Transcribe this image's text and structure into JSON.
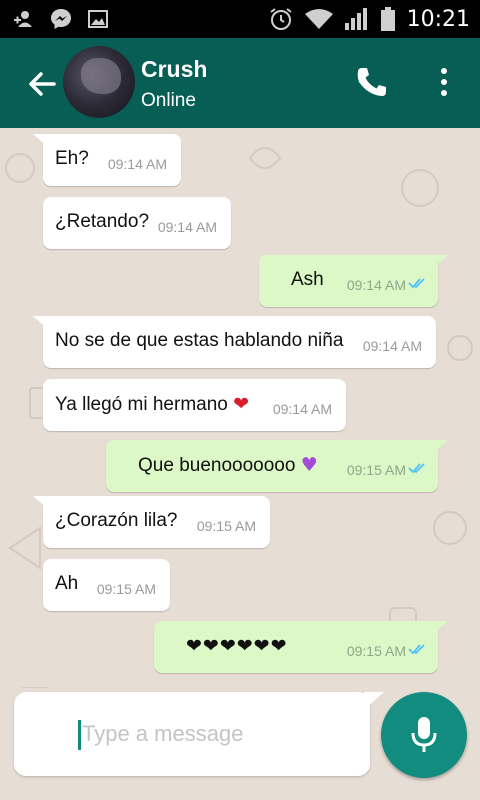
{
  "status_bar": {
    "time": "10:21"
  },
  "header": {
    "contact_name": "Crush",
    "contact_status": "Online"
  },
  "messages": [
    {
      "direction": "in",
      "text": "Eh?",
      "time": "09:14 AM"
    },
    {
      "direction": "in",
      "text": "¿Retando?",
      "time": "09:14 AM"
    },
    {
      "direction": "out",
      "text": "Ash",
      "time": "09:14 AM",
      "read": true
    },
    {
      "direction": "in",
      "text": "No se de que estas hablando niña",
      "time": "09:14 AM"
    },
    {
      "direction": "in",
      "text": "Ya llegó mi hermano",
      "emoji": "❤",
      "time": "09:14 AM"
    },
    {
      "direction": "out",
      "text": "Que buenooooooo",
      "emoji": "♥",
      "time": "09:15 AM",
      "read": true
    },
    {
      "direction": "in",
      "text": "¿Corazón lila?",
      "time": "09:15 AM"
    },
    {
      "direction": "in",
      "text": "Ah",
      "time": "09:15 AM"
    },
    {
      "direction": "out",
      "text": "❤❤❤❤❤❤",
      "time": "09:15 AM",
      "read": true
    }
  ],
  "composer": {
    "placeholder": "Type a message",
    "value": ""
  },
  "icons": {
    "status_left": [
      "person-add-icon",
      "messenger-icon",
      "image-icon"
    ],
    "status_right": [
      "alarm-icon",
      "wifi-icon",
      "signal-icon",
      "battery-icon"
    ],
    "header": [
      "back-arrow-icon",
      "phone-icon",
      "more-vert-icon"
    ],
    "read_receipt": "double-check-icon",
    "composer": "mic-icon"
  },
  "colors": {
    "header": "#075e54",
    "chat_background": "#e6ddd4",
    "incoming_bubble": "#ffffff",
    "outgoing_bubble": "#dcf8c6",
    "read_tick": "#4fc3f7",
    "mic_button": "#128c7e",
    "heart_red": "#d81e2a",
    "heart_purple": "#a24bd9"
  }
}
